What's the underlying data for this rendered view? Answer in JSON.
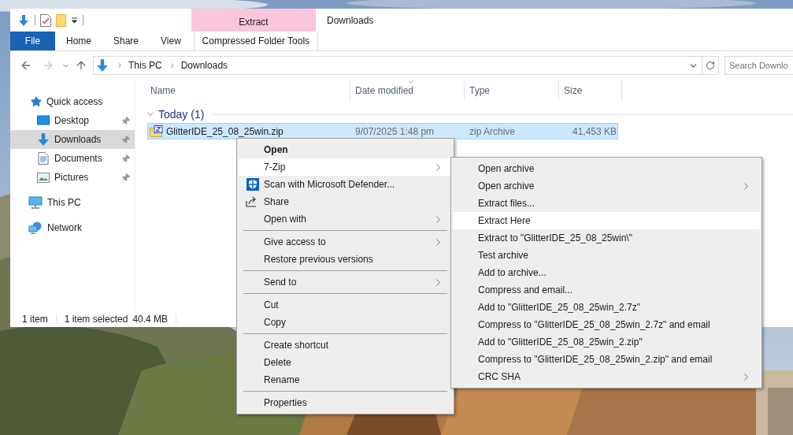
{
  "window": {
    "title": "Downloads"
  },
  "ribbon": {
    "contextual_header": "Extract",
    "tabs": [
      {
        "label": "File",
        "kind": "file"
      },
      {
        "label": "Home",
        "kind": "tab"
      },
      {
        "label": "Share",
        "kind": "tab"
      },
      {
        "label": "View",
        "kind": "tab"
      },
      {
        "label": "Compressed Folder Tools",
        "kind": "contextual"
      }
    ]
  },
  "navigation": [
    {
      "kind": "back",
      "disabled": false
    },
    {
      "kind": "forward",
      "disabled": true
    },
    {
      "kind": "recent",
      "disabled": false
    },
    {
      "kind": "up",
      "disabled": false
    }
  ],
  "address": {
    "path": [
      "This PC",
      "Downloads"
    ]
  },
  "search": {
    "placeholder": "Search Downlo"
  },
  "sidebar": {
    "items": [
      {
        "label": "Quick access",
        "kind": "quick",
        "selected": false,
        "children": [
          {
            "label": "Desktop",
            "kind": "desktop",
            "pinned": true,
            "selected": false
          },
          {
            "label": "Downloads",
            "kind": "downloads",
            "pinned": true,
            "selected": true
          },
          {
            "label": "Documents",
            "kind": "documents",
            "pinned": true,
            "selected": false
          },
          {
            "label": "Pictures",
            "kind": "pictures",
            "pinned": true,
            "selected": false
          }
        ]
      },
      {
        "label": "This PC",
        "kind": "pc",
        "selected": false
      },
      {
        "label": "Network",
        "kind": "network",
        "selected": false
      }
    ]
  },
  "file_list": {
    "columns": [
      {
        "label": "Name",
        "sorted": false
      },
      {
        "label": "Date modified",
        "sorted": true
      },
      {
        "label": "Type",
        "sorted": false
      },
      {
        "label": "Size",
        "sorted": false
      }
    ],
    "groups": [
      {
        "label": "Today (1)",
        "expanded": true,
        "rows": [
          {
            "name": "GlitterIDE_25_08_25win.zip",
            "date": "9/07/2025 1:48 pm",
            "type": "zip Archive",
            "size": "41,453 KB",
            "selected": true
          }
        ]
      }
    ]
  },
  "status_bar": {
    "item_count": "1 item",
    "selection": "1 item selected",
    "selection_size": "40.4 MB"
  },
  "context_menu": {
    "items": [
      {
        "kind": "item",
        "label": "Open",
        "bold": true,
        "submenu": false,
        "selected": false
      },
      {
        "kind": "item",
        "label": "7-Zip",
        "bold": false,
        "submenu": true,
        "selected": true
      },
      {
        "kind": "defender",
        "label": "Scan with Microsoft Defender...",
        "bold": false,
        "submenu": false,
        "selected": false
      },
      {
        "kind": "share",
        "label": "Share",
        "bold": false,
        "submenu": false,
        "selected": false
      },
      {
        "kind": "item",
        "label": "Open with",
        "bold": false,
        "submenu": true,
        "selected": false
      },
      {
        "kind": "separator"
      },
      {
        "kind": "item",
        "label": "Give access to",
        "bold": false,
        "submenu": true,
        "selected": false
      },
      {
        "kind": "item",
        "label": "Restore previous versions",
        "bold": false,
        "submenu": false,
        "selected": false
      },
      {
        "kind": "separator"
      },
      {
        "kind": "item",
        "label": "Send to",
        "bold": false,
        "submenu": true,
        "selected": false
      },
      {
        "kind": "separator"
      },
      {
        "kind": "item",
        "label": "Cut",
        "bold": false,
        "submenu": false,
        "selected": false
      },
      {
        "kind": "item",
        "label": "Copy",
        "bold": false,
        "submenu": false,
        "selected": false
      },
      {
        "kind": "separator"
      },
      {
        "kind": "item",
        "label": "Create shortcut",
        "bold": false,
        "submenu": false,
        "selected": false
      },
      {
        "kind": "item",
        "label": "Delete",
        "bold": false,
        "submenu": false,
        "selected": false
      },
      {
        "kind": "item",
        "label": "Rename",
        "bold": false,
        "submenu": false,
        "selected": false
      },
      {
        "kind": "separator"
      },
      {
        "kind": "item",
        "label": "Properties",
        "bold": false,
        "submenu": false,
        "selected": false
      }
    ]
  },
  "submenu": {
    "items": [
      {
        "kind": "item",
        "label": "Open archive",
        "bold": false,
        "submenu": false,
        "selected": false
      },
      {
        "kind": "item",
        "label": "Open archive",
        "bold": false,
        "submenu": true,
        "selected": false
      },
      {
        "kind": "item",
        "label": "Extract files...",
        "bold": false,
        "submenu": false,
        "selected": false
      },
      {
        "kind": "item",
        "label": "Extract Here",
        "bold": false,
        "submenu": false,
        "selected": true
      },
      {
        "kind": "item",
        "label": "Extract to \"GlitterIDE_25_08_25win\\\"",
        "bold": false,
        "submenu": false,
        "selected": false
      },
      {
        "kind": "item",
        "label": "Test archive",
        "bold": false,
        "submenu": false,
        "selected": false
      },
      {
        "kind": "item",
        "label": "Add to archive...",
        "bold": false,
        "submenu": false,
        "selected": false
      },
      {
        "kind": "item",
        "label": "Compress and email...",
        "bold": false,
        "submenu": false,
        "selected": false
      },
      {
        "kind": "item",
        "label": "Add to \"GlitterIDE_25_08_25win_2.7z\"",
        "bold": false,
        "submenu": false,
        "selected": false
      },
      {
        "kind": "item",
        "label": "Compress to \"GlitterIDE_25_08_25win_2.7z\" and email",
        "bold": false,
        "submenu": false,
        "selected": false
      },
      {
        "kind": "item",
        "label": "Add to \"GlitterIDE_25_08_25win_2.zip\"",
        "bold": false,
        "submenu": false,
        "selected": false
      },
      {
        "kind": "item",
        "label": "Compress to \"GlitterIDE_25_08_25win_2.zip\" and email",
        "bold": false,
        "submenu": false,
        "selected": false
      },
      {
        "kind": "item",
        "label": "CRC SHA",
        "bold": false,
        "submenu": true,
        "selected": false
      }
    ]
  }
}
